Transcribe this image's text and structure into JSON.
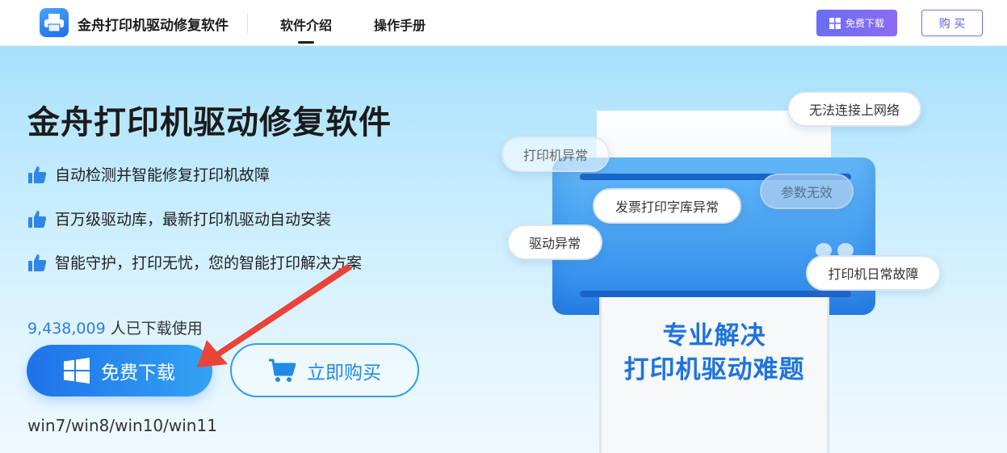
{
  "header": {
    "brand": "金舟打印机驱动修复软件",
    "nav": [
      {
        "label": "软件介绍",
        "active": true
      },
      {
        "label": "操作手册",
        "active": false
      }
    ],
    "download_label": "免费下载",
    "buy_label": "购 买"
  },
  "hero": {
    "title": "金舟打印机驱动修复软件",
    "features": [
      "自动检测并智能修复打印机故障",
      "百万级驱动库，最新打印机驱动自动安装",
      "智能守护，打印无忧，您的智能打印解决方案"
    ],
    "download_count": "9,438,009",
    "download_suffix": " 人已下载使用",
    "download_button": "免费下载",
    "buy_button": "立即购买",
    "os_support": "win7/win8/win10/win11"
  },
  "illustration": {
    "bubbles": [
      "无法连接上网络",
      "打印机异常",
      "参数无效",
      "发票打印字库异常",
      "驱动异常",
      "打印机日常故障"
    ],
    "paper_line1": "专业解决",
    "paper_line2": "打印机驱动难题"
  },
  "colors": {
    "accent_blue": "#1f72e8",
    "purple_button": "#7a6cf5",
    "arrow_red": "#e8443a"
  }
}
